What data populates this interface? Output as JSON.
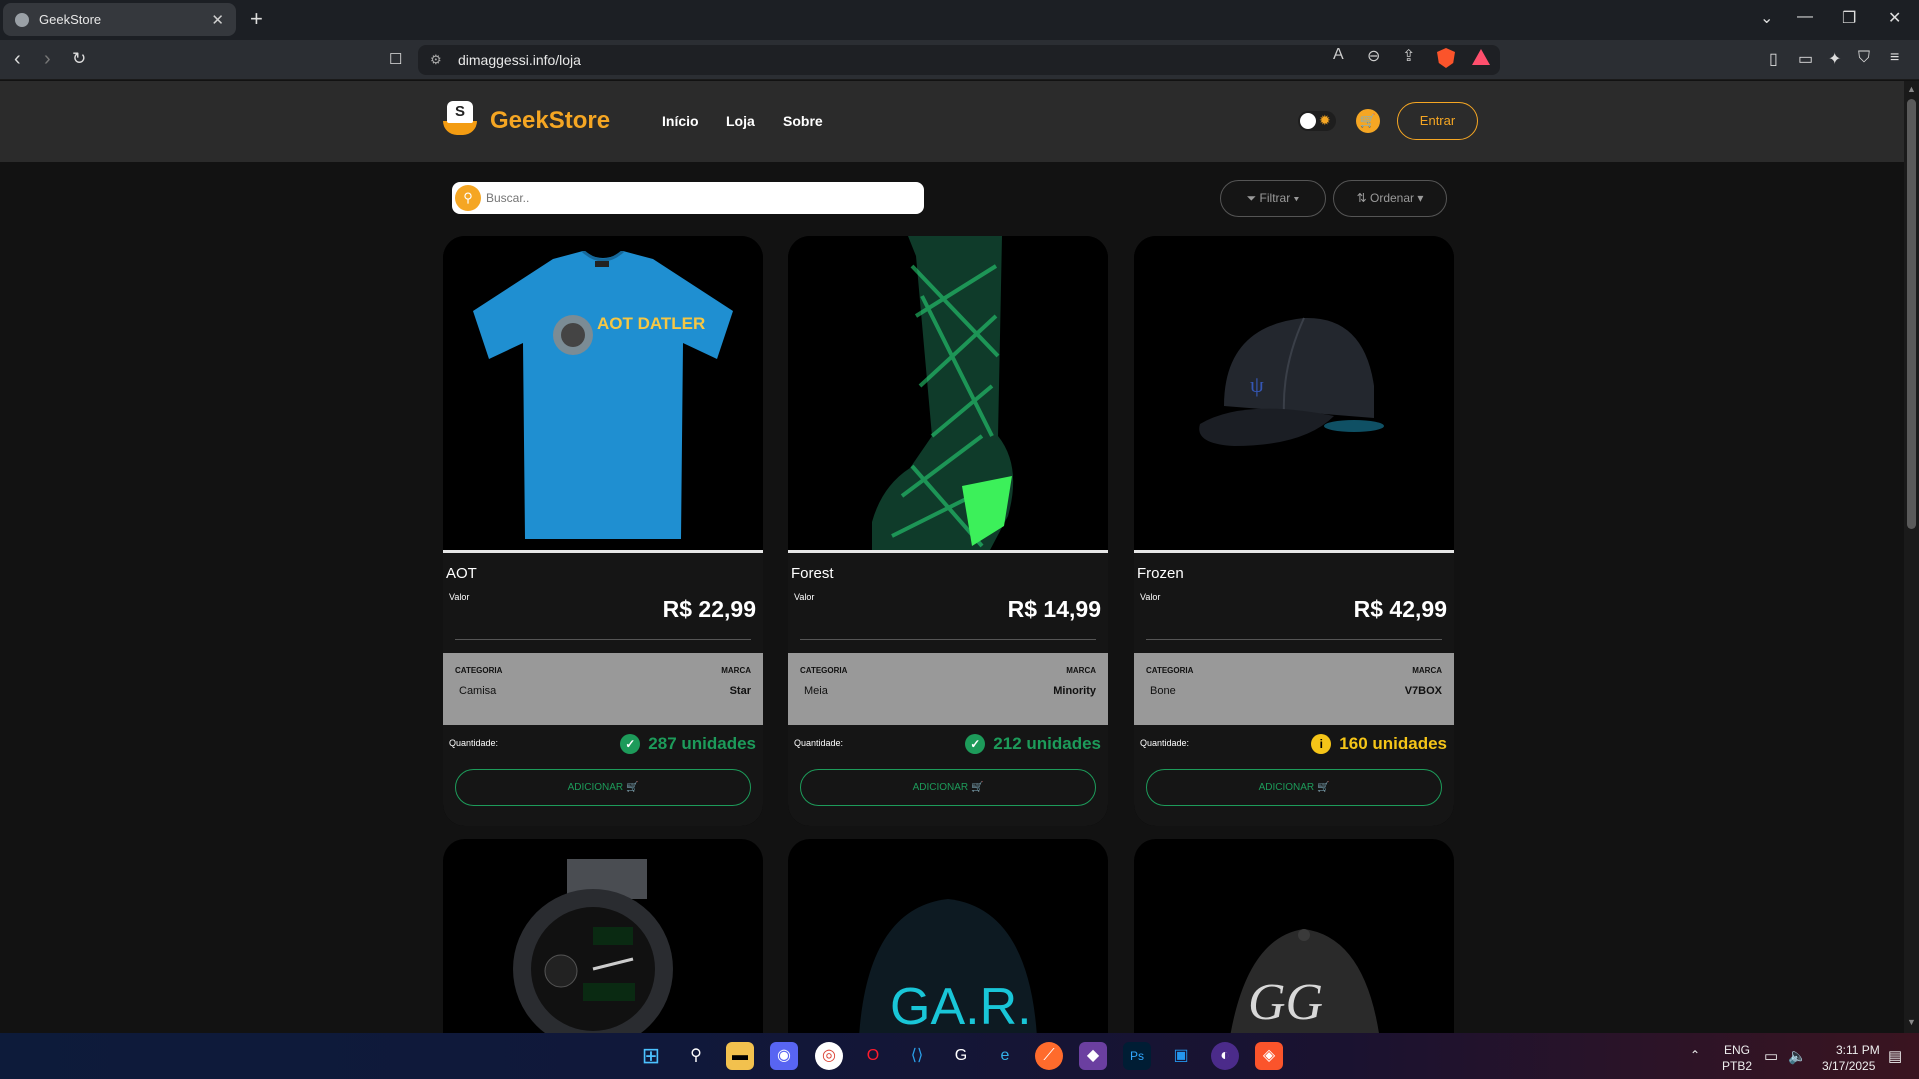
{
  "browser": {
    "tab_title": "GeekStore",
    "url": "dimaggessi.info/loja"
  },
  "site": {
    "brand": "GeekStore",
    "logo_letter": "S",
    "nav": [
      "Início",
      "Loja",
      "Sobre"
    ],
    "login_label": "Entrar",
    "search_placeholder": "Buscar..",
    "filter_label": "Filtrar",
    "sort_label": "Ordenar",
    "accent_color": "#f5a623",
    "success_color": "#1d9b5a"
  },
  "labels": {
    "value": "Valor",
    "category": "CATEGORIA",
    "brand": "MARCA",
    "quantity": "Quantidade:",
    "add": "ADICIONAR"
  },
  "products": [
    {
      "name": "AOT",
      "price": "R$ 22,99",
      "category": "Camisa",
      "brand": "Star",
      "quantity": "287 unidades",
      "stock_status": "ok",
      "image_text": "AOT DATLER"
    },
    {
      "name": "Forest",
      "price": "R$ 14,99",
      "category": "Meia",
      "brand": "Minority",
      "quantity": "212 unidades",
      "stock_status": "ok"
    },
    {
      "name": "Frozen",
      "price": "R$ 42,99",
      "category": "Bone",
      "brand": "V7BOX",
      "quantity": "160 unidades",
      "stock_status": "warning"
    }
  ],
  "second_row_images": [
    {
      "image_text": ""
    },
    {
      "image_text": "GA.R."
    },
    {
      "image_text": "GG"
    }
  ],
  "taskbar": {
    "lang": "ENG",
    "layout": "PTB2",
    "time": "3:11 PM",
    "date": "3/17/2025"
  }
}
